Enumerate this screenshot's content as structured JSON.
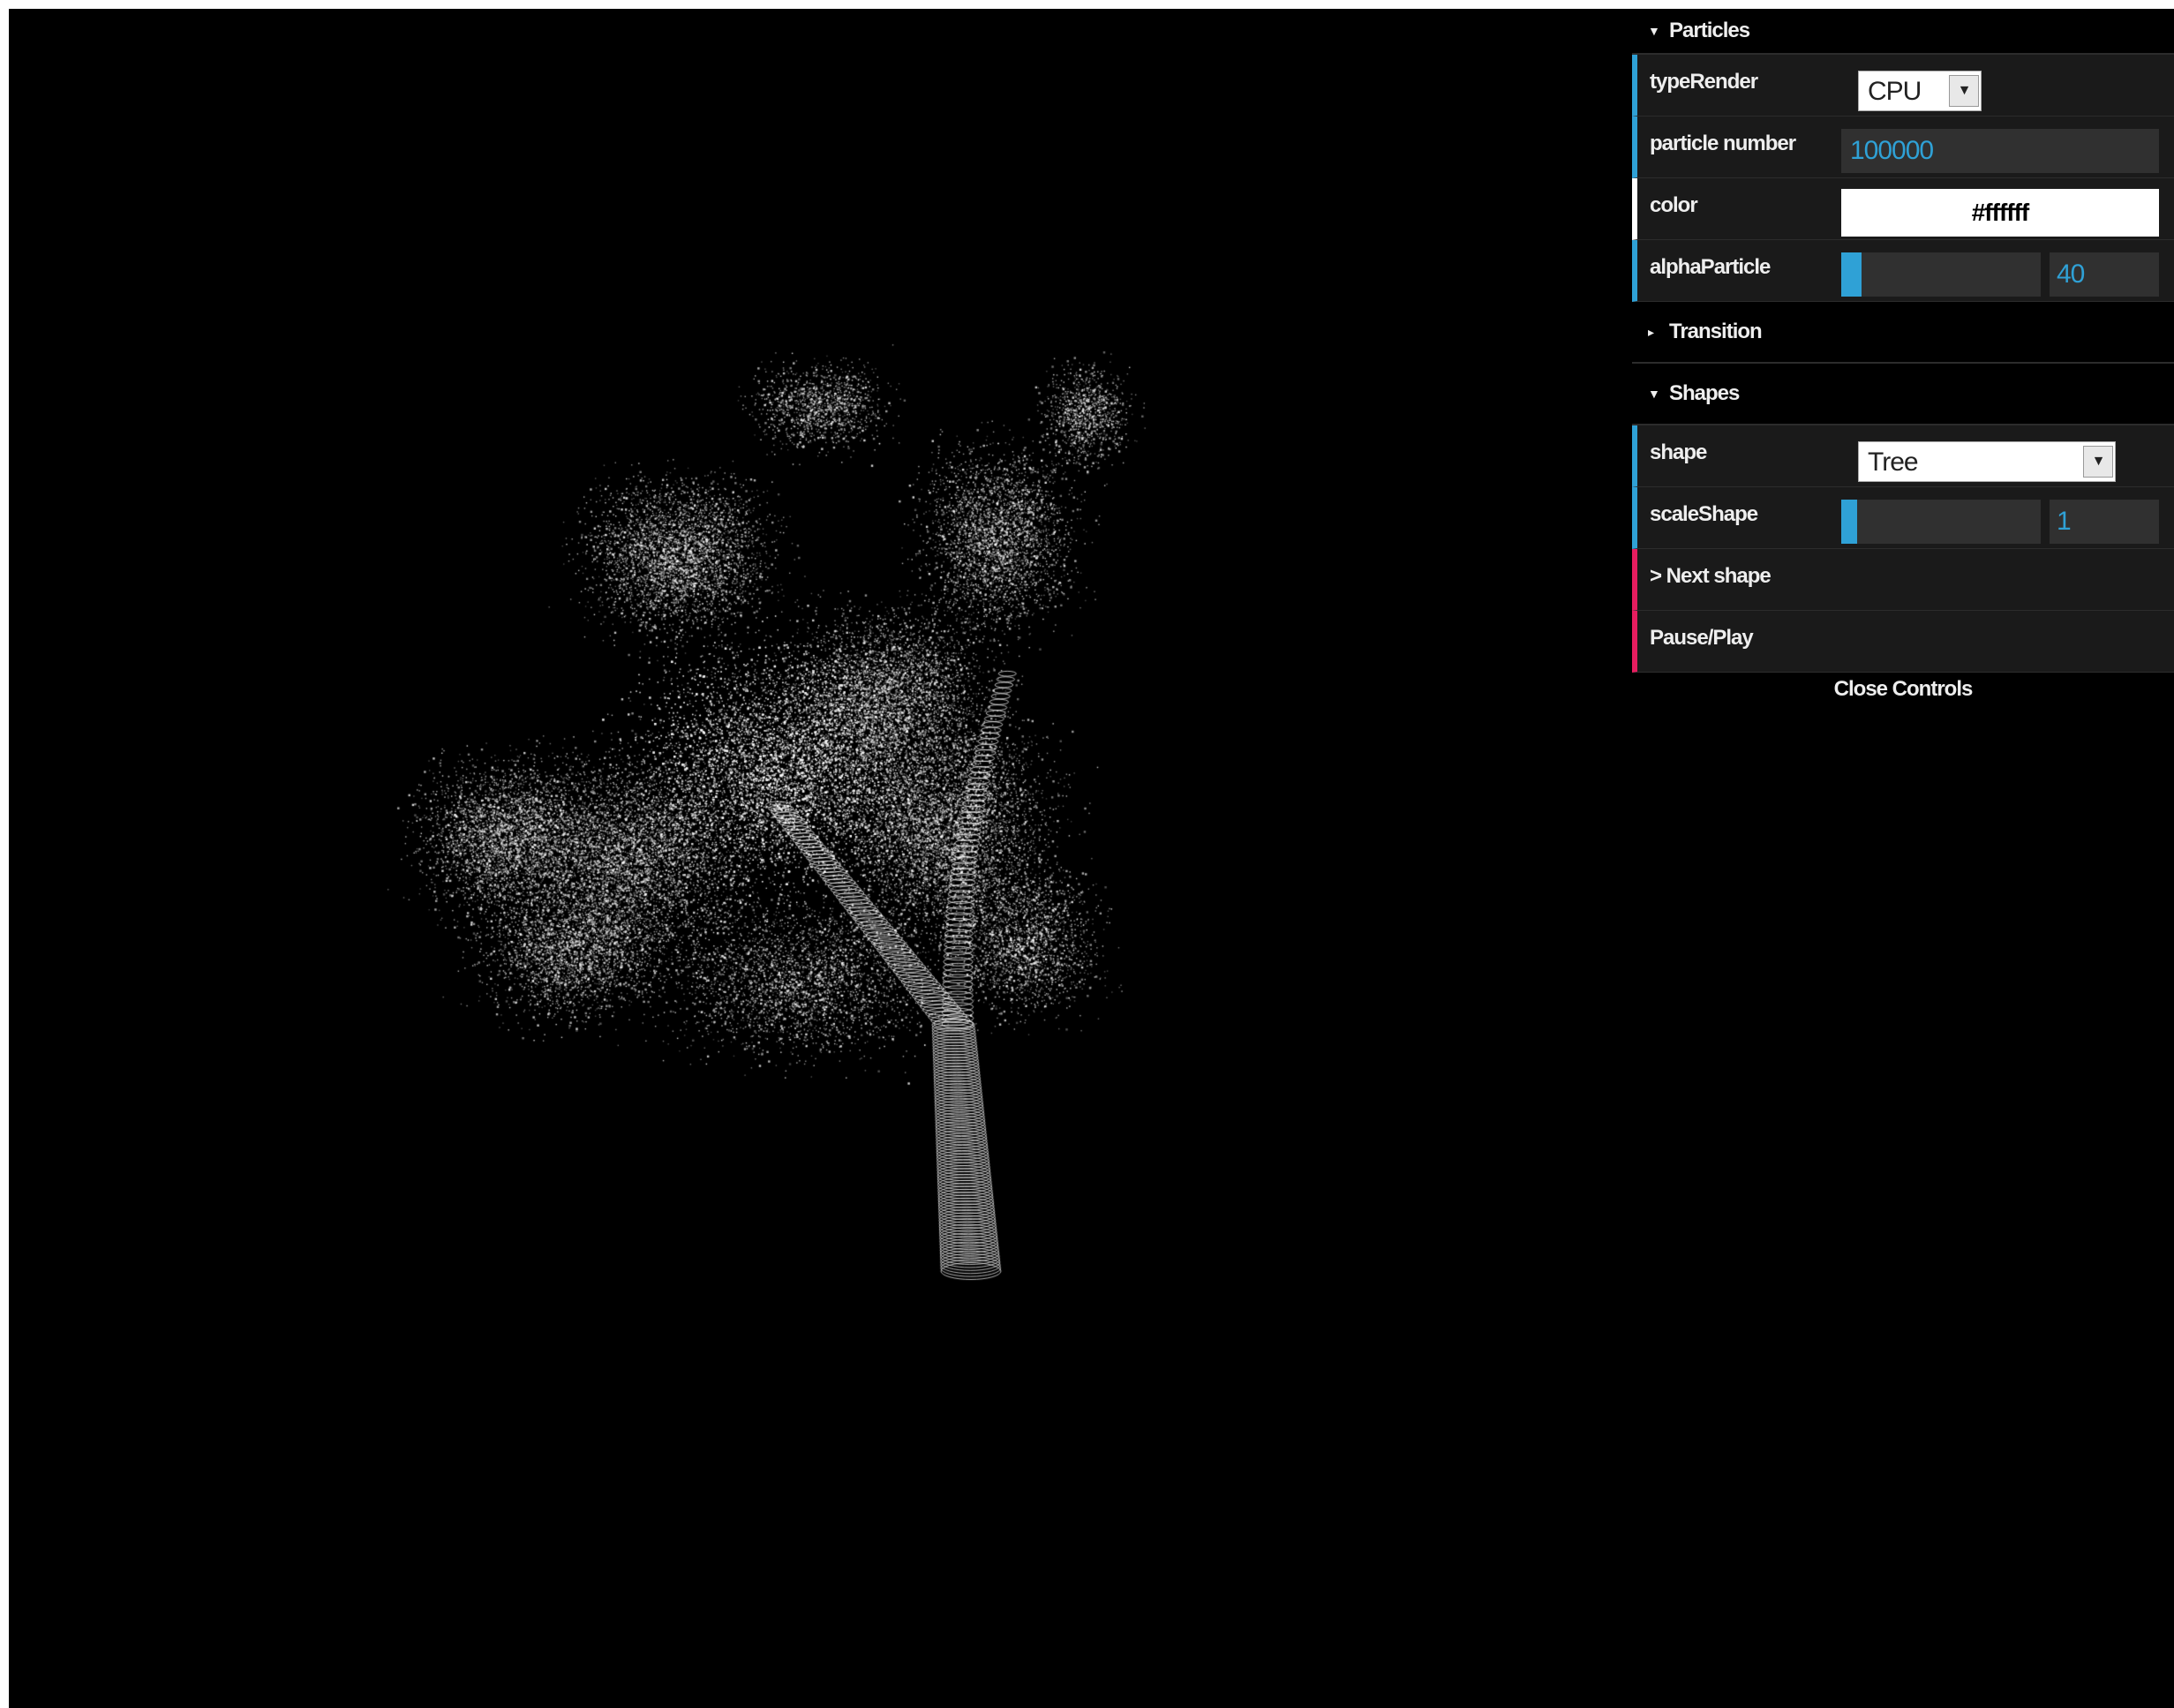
{
  "gui": {
    "folders": {
      "particles": {
        "title": "Particles",
        "typeRender": {
          "label": "typeRender",
          "value": "CPU"
        },
        "particleNumber": {
          "label": "particle number",
          "value": "100000"
        },
        "color": {
          "label": "color",
          "value": "#ffffff"
        },
        "alphaParticle": {
          "label": "alphaParticle",
          "value": "40",
          "fraction": 0.1
        }
      },
      "transition": {
        "title": "Transition"
      },
      "shapes": {
        "title": "Shapes",
        "shape": {
          "label": "shape",
          "value": "Tree"
        },
        "scaleShape": {
          "label": "scaleShape",
          "value": "1",
          "fraction": 0.08
        },
        "nextShape": {
          "label": "> Next shape"
        },
        "pausePlay": {
          "label": "Pause/Play"
        }
      }
    },
    "closeControls": "Close Controls"
  },
  "icons": {
    "folderOpen": "triangle-down-icon",
    "folderClosed": "triangle-right-icon",
    "dropdown": "chevron-down-icon"
  },
  "colors": {
    "background": "#000000",
    "particle": "#ffffff",
    "numberAccent": "#2fa1d6",
    "functionAccent": "#e61d5f",
    "colorAccent": "#ffffff"
  }
}
